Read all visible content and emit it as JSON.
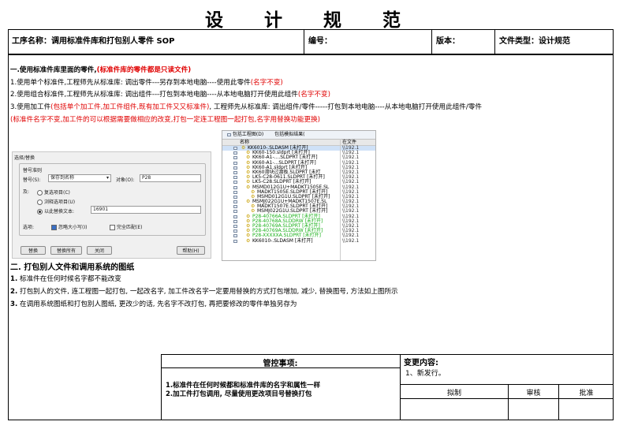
{
  "title": "设 计 规 范",
  "header": {
    "process_name": "工序名称：调用标准件库和打包别人零件 SOP",
    "number_label": "编号：",
    "version_label": "版本：",
    "doc_type": "文件类型：设计规范"
  },
  "section1": {
    "heading_black": "一.使用标准件库里面的零件,",
    "heading_red": "(标准件库的零件都是只读文件)",
    "line1_black": "1.使用单个标准件,工程师先从标准库:   调出零件---另存到本地电脑----使用此零件",
    "line1_red": "(名字不变)",
    "line2_black": "2.使用组合标准件,工程师先从标准库:   调出组件---打包到本地电脑----从本地电脑打开使用此组件",
    "line2_red": "(名字不变)",
    "line3_a": "3.使用加工件",
    "line3_red": "(包括单个加工件,加工件组件,既有加工件又又标准件)",
    "line3_b": ", 工程师先从标准库:   调出组件/零件-----打包到本地电脑----从本地电脑打开使用此组件/零件",
    "line4_red": "(标准件名字不变,加工件的可以根据需要做相应的改变,打包一定连工程图一起打包,名字用替换功能更换)"
  },
  "dialog": {
    "title": "选择/替换",
    "group": "替号准则",
    "replace_label": "替号(S):",
    "replace_value": "保存到名称",
    "object_label": "对象(O):",
    "object_value": "P28",
    "and_label": "及:",
    "opt1": "复选项目(C)",
    "opt2": "浏释选项目(U)",
    "opt3": "以此替换文本:",
    "opt3_value": "16901",
    "options_label": "选项:",
    "chk1": "忽略大小写(I)",
    "chk2": "完全匹配(E)",
    "btn_replace": "替换",
    "btn_replace_all": "替换所有",
    "btn_close": "关闭",
    "btn_help": "帮助(H)"
  },
  "tree": {
    "tab1": "包括工程图(D)",
    "tab2": "包括模拟结果(",
    "col_name": "名称",
    "col_path": "在文件",
    "rows": [
      {
        "name": "KK6010-.SLDASM [未打开]",
        "path": "\\\\192.1",
        "indent": 0,
        "green": false,
        "sel": true
      },
      {
        "name": "KK60-150.sldprt [未打开]",
        "path": "\\\\192.1",
        "indent": 1,
        "green": false,
        "sel": false
      },
      {
        "name": "KK60-A1-....SLDPRT [未打开]",
        "path": "\\\\192.1",
        "indent": 1,
        "green": false,
        "sel": false
      },
      {
        "name": "KK60-A1-...SLDPRT [未打开]",
        "path": "\\\\192.1",
        "indent": 1,
        "green": false,
        "sel": false
      },
      {
        "name": "KK60-A1.sldprt [未打开]",
        "path": "\\\\192.1",
        "indent": 1,
        "green": false,
        "sel": false
      },
      {
        "name": "KK60滑块过渡板.SLDPRT [未打",
        "path": "\\\\192.1",
        "indent": 1,
        "green": false,
        "sel": false
      },
      {
        "name": "LK5-C28-0611.SLDPRT [未打开]",
        "path": "\\\\192.1",
        "indent": 1,
        "green": false,
        "sel": false
      },
      {
        "name": "LK5-C28.SLDPRT [未打开]",
        "path": "\\\\192.1",
        "indent": 1,
        "green": false,
        "sel": false
      },
      {
        "name": "MSMD012G1U+MADKT1505E.SL",
        "path": "\\\\192.1",
        "indent": 1,
        "green": false,
        "sel": false
      },
      {
        "name": "MADKT1505E.SLDPRT [未打开]",
        "path": "\\\\192.1",
        "indent": 2,
        "green": false,
        "sel": false
      },
      {
        "name": "MSMD012G1U.SLDPRT [未打开]",
        "path": "\\\\192.1",
        "indent": 2,
        "green": false,
        "sel": false
      },
      {
        "name": "MSMJ022G1U+MADKT1507E.SL",
        "path": "\\\\192.1",
        "indent": 1,
        "green": false,
        "sel": false
      },
      {
        "name": "MADKT1507E.SLDPRT [未打开]",
        "path": "\\\\192.1",
        "indent": 2,
        "green": false,
        "sel": false
      },
      {
        "name": "MSMJ022G1U.SLDPRT [未打开]",
        "path": "\\\\192.1",
        "indent": 2,
        "green": false,
        "sel": false
      },
      {
        "name": "P28-40766A.SLDPRT [未打开]",
        "path": "\\\\192.1",
        "indent": 1,
        "green": true,
        "sel": false
      },
      {
        "name": "P28-40768A.SLDDRW [未打开]",
        "path": "\\\\192.1",
        "indent": 1,
        "green": true,
        "sel": false
      },
      {
        "name": "P28-40769A.SLDPRT [未打开]",
        "path": "\\\\192.1",
        "indent": 1,
        "green": true,
        "sel": false
      },
      {
        "name": "P28-40769A.SLDDRW [未打开]",
        "path": "\\\\192.1",
        "indent": 1,
        "green": true,
        "sel": false
      },
      {
        "name": "P28-XXXXXA.SLDPRT [未打开]",
        "path": "\\\\192.1",
        "indent": 1,
        "green": true,
        "sel": false
      },
      {
        "name": "KK6010-.SLDASM [未打开]",
        "path": "\\\\192.1",
        "indent": 1,
        "green": false,
        "sel": false
      }
    ]
  },
  "section2": {
    "heading": "二. 打包别人文件和调用系统的图纸",
    "item1_num": "1.",
    "item1": " 标准件在任何时候名字都不能改变",
    "item2_num": "2.",
    "item2": " 打包别人的文件, 连工程图一起打包, 一起改名字, 加工件改名字一定要用替换的方式打包增加, 减少, 替换图号, 方法如上图所示",
    "item3_num": "3.",
    "item3": " 在调用系统图纸和打包别人图纸, 更改少的话, 先名字不改打包, 再把要修改的零件单独另存为"
  },
  "footer": {
    "control_title": "管控事项:",
    "control_item1": "1.标准件在任何时候都和标准件库的名字和属性一样",
    "control_item2": "2.加工件打包调用, 尽量使用更改项目号替换打包",
    "change_title": "变更内容:",
    "change_item1": "1、新发行。",
    "draft": "拟制",
    "review": "审核",
    "approve": "批准"
  }
}
